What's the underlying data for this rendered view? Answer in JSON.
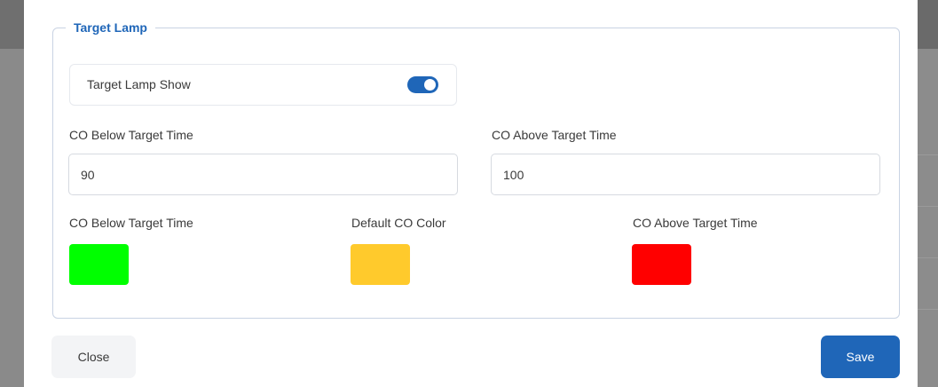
{
  "section": {
    "title": "Target Lamp"
  },
  "toggle": {
    "label": "Target Lamp Show",
    "enabled": true
  },
  "inputs": {
    "below": {
      "label": "CO Below Target Time",
      "value": "90"
    },
    "above": {
      "label": "CO Above Target Time",
      "value": "100"
    }
  },
  "colors": {
    "below": {
      "label": "CO Below Target Time",
      "color": "#00ff00"
    },
    "default": {
      "label": "Default CO Color",
      "color": "#ffca2c"
    },
    "above": {
      "label": "CO Above Target Time",
      "color": "#ff0000"
    }
  },
  "buttons": {
    "close": "Close",
    "save": "Save"
  },
  "theme": {
    "accent": "#1f66b8"
  }
}
